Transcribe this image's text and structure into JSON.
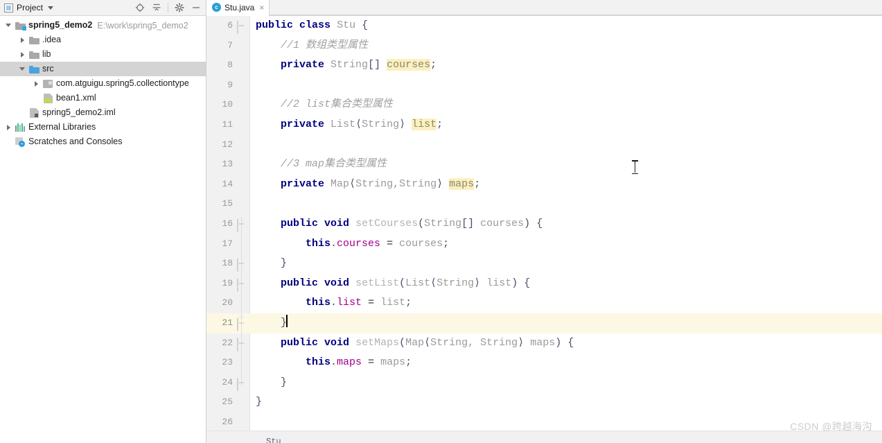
{
  "project_panel": {
    "title": "Project",
    "icon": "project-window-icon",
    "toolbar_buttons": [
      {
        "name": "locate-in-tree-icon",
        "tooltip": "Select Opened File"
      },
      {
        "name": "collapse-all-icon",
        "tooltip": "Collapse All"
      },
      {
        "name": "gear-icon",
        "tooltip": "Settings"
      },
      {
        "name": "minimize-icon",
        "tooltip": "Hide"
      }
    ],
    "tree": [
      {
        "label": "spring5_demo2",
        "sublabel": "E:\\work\\spring5_demo2",
        "icon": "module-folder-icon",
        "indent": 0,
        "twisty": "open",
        "bold": true,
        "selected": false
      },
      {
        "label": ".idea",
        "sublabel": "",
        "icon": "folder-gray-icon",
        "indent": 1,
        "twisty": "closed",
        "bold": false,
        "selected": false
      },
      {
        "label": "lib",
        "sublabel": "",
        "icon": "folder-gray-icon",
        "indent": 1,
        "twisty": "closed",
        "bold": false,
        "selected": false
      },
      {
        "label": "src",
        "sublabel": "",
        "icon": "folder-blue-icon",
        "indent": 1,
        "twisty": "open",
        "bold": false,
        "selected": true
      },
      {
        "label": "com.atguigu.spring5.collectiontype",
        "sublabel": "",
        "icon": "package-icon",
        "indent": 2,
        "twisty": "closed",
        "bold": false,
        "selected": false
      },
      {
        "label": "bean1.xml",
        "sublabel": "",
        "icon": "xml-file-icon",
        "indent": 2,
        "twisty": "none",
        "bold": false,
        "selected": false
      },
      {
        "label": "spring5_demo2.iml",
        "sublabel": "",
        "icon": "iml-file-icon",
        "indent": 1,
        "twisty": "none",
        "bold": false,
        "selected": false
      },
      {
        "label": "External Libraries",
        "sublabel": "",
        "icon": "external-libraries-icon",
        "indent": 0,
        "twisty": "closed",
        "bold": false,
        "selected": false
      },
      {
        "label": "Scratches and Consoles",
        "sublabel": "",
        "icon": "scratches-icon",
        "indent": 0,
        "twisty": "none",
        "bold": false,
        "selected": false
      }
    ]
  },
  "editor": {
    "tab": {
      "label": "Stu.java",
      "icon": "java-class-icon",
      "close": "×"
    },
    "breadcrumb": "Stu",
    "current_line": 21,
    "first_line": 6,
    "lines": [
      {
        "n": 6,
        "fold": "down",
        "tokens": [
          {
            "t": "public",
            "c": "kw"
          },
          {
            "t": " ",
            "c": "plain"
          },
          {
            "t": "class",
            "c": "kw"
          },
          {
            "t": " ",
            "c": "plain"
          },
          {
            "t": "Stu",
            "c": "type"
          },
          {
            "t": " ",
            "c": "plain"
          },
          {
            "t": "{",
            "c": "punct"
          }
        ]
      },
      {
        "n": 7,
        "fold": "none",
        "tokens": [
          {
            "t": "    //1 数组类型属性",
            "c": "cmt"
          }
        ]
      },
      {
        "n": 8,
        "fold": "none",
        "tokens": [
          {
            "t": "    ",
            "c": "plain"
          },
          {
            "t": "private",
            "c": "kw"
          },
          {
            "t": " ",
            "c": "plain"
          },
          {
            "t": "String",
            "c": "type"
          },
          {
            "t": "[]",
            "c": "punct"
          },
          {
            "t": " ",
            "c": "plain"
          },
          {
            "t": "courses",
            "c": "hl"
          },
          {
            "t": ";",
            "c": "punct"
          }
        ]
      },
      {
        "n": 9,
        "fold": "none",
        "tokens": []
      },
      {
        "n": 10,
        "fold": "none",
        "tokens": [
          {
            "t": "    //2 list集合类型属性",
            "c": "cmt"
          }
        ]
      },
      {
        "n": 11,
        "fold": "none",
        "tokens": [
          {
            "t": "    ",
            "c": "plain"
          },
          {
            "t": "private",
            "c": "kw"
          },
          {
            "t": " ",
            "c": "plain"
          },
          {
            "t": "List",
            "c": "type"
          },
          {
            "t": "⟨",
            "c": "punct"
          },
          {
            "t": "String",
            "c": "type"
          },
          {
            "t": "⟩",
            "c": "punct"
          },
          {
            "t": " ",
            "c": "plain"
          },
          {
            "t": "list",
            "c": "hl"
          },
          {
            "t": ";",
            "c": "punct"
          }
        ]
      },
      {
        "n": 12,
        "fold": "none",
        "tokens": []
      },
      {
        "n": 13,
        "fold": "none",
        "tokens": [
          {
            "t": "    //3 map集合类型属性",
            "c": "cmt"
          }
        ]
      },
      {
        "n": 14,
        "fold": "none",
        "tokens": [
          {
            "t": "    ",
            "c": "plain"
          },
          {
            "t": "private",
            "c": "kw"
          },
          {
            "t": " ",
            "c": "plain"
          },
          {
            "t": "Map",
            "c": "type"
          },
          {
            "t": "⟨",
            "c": "punct"
          },
          {
            "t": "String,String",
            "c": "type"
          },
          {
            "t": "⟩",
            "c": "punct"
          },
          {
            "t": " ",
            "c": "plain"
          },
          {
            "t": "maps",
            "c": "hl"
          },
          {
            "t": ";",
            "c": "punct"
          }
        ]
      },
      {
        "n": 15,
        "fold": "none",
        "tokens": []
      },
      {
        "n": 16,
        "fold": "down",
        "tokens": [
          {
            "t": "    ",
            "c": "plain"
          },
          {
            "t": "public",
            "c": "kw"
          },
          {
            "t": " ",
            "c": "plain"
          },
          {
            "t": "void",
            "c": "kw"
          },
          {
            "t": " ",
            "c": "plain"
          },
          {
            "t": "setCourses",
            "c": "method"
          },
          {
            "t": "(",
            "c": "punct"
          },
          {
            "t": "String",
            "c": "type"
          },
          {
            "t": "[]",
            "c": "punct"
          },
          {
            "t": " ",
            "c": "plain"
          },
          {
            "t": "courses",
            "c": "type"
          },
          {
            "t": ")",
            "c": "punct"
          },
          {
            "t": " ",
            "c": "plain"
          },
          {
            "t": "{",
            "c": "punct"
          }
        ]
      },
      {
        "n": 17,
        "fold": "none",
        "tokens": [
          {
            "t": "        ",
            "c": "plain"
          },
          {
            "t": "this",
            "c": "kw"
          },
          {
            "t": ".",
            "c": "punct"
          },
          {
            "t": "courses",
            "c": "field"
          },
          {
            "t": " = ",
            "c": "plain"
          },
          {
            "t": "courses",
            "c": "type"
          },
          {
            "t": ";",
            "c": "punct"
          }
        ]
      },
      {
        "n": 18,
        "fold": "up",
        "tokens": [
          {
            "t": "    ",
            "c": "plain"
          },
          {
            "t": "}",
            "c": "punct"
          }
        ]
      },
      {
        "n": 19,
        "fold": "down",
        "tokens": [
          {
            "t": "    ",
            "c": "plain"
          },
          {
            "t": "public",
            "c": "kw"
          },
          {
            "t": " ",
            "c": "plain"
          },
          {
            "t": "void",
            "c": "kw"
          },
          {
            "t": " ",
            "c": "plain"
          },
          {
            "t": "setList",
            "c": "method"
          },
          {
            "t": "(",
            "c": "punct"
          },
          {
            "t": "List",
            "c": "type"
          },
          {
            "t": "⟨",
            "c": "punct"
          },
          {
            "t": "String",
            "c": "type"
          },
          {
            "t": "⟩",
            "c": "punct"
          },
          {
            "t": " ",
            "c": "plain"
          },
          {
            "t": "list",
            "c": "type"
          },
          {
            "t": ")",
            "c": "punct"
          },
          {
            "t": " ",
            "c": "plain"
          },
          {
            "t": "{",
            "c": "punct"
          }
        ]
      },
      {
        "n": 20,
        "fold": "none",
        "tokens": [
          {
            "t": "        ",
            "c": "plain"
          },
          {
            "t": "this",
            "c": "kw"
          },
          {
            "t": ".",
            "c": "punct"
          },
          {
            "t": "list",
            "c": "field"
          },
          {
            "t": " = ",
            "c": "plain"
          },
          {
            "t": "list",
            "c": "type"
          },
          {
            "t": ";",
            "c": "punct"
          }
        ]
      },
      {
        "n": 21,
        "fold": "up",
        "caret": true,
        "tokens": [
          {
            "t": "    ",
            "c": "plain"
          },
          {
            "t": "}",
            "c": "punct"
          }
        ]
      },
      {
        "n": 22,
        "fold": "down",
        "tokens": [
          {
            "t": "    ",
            "c": "plain"
          },
          {
            "t": "public",
            "c": "kw"
          },
          {
            "t": " ",
            "c": "plain"
          },
          {
            "t": "void",
            "c": "kw"
          },
          {
            "t": " ",
            "c": "plain"
          },
          {
            "t": "setMaps",
            "c": "method"
          },
          {
            "t": "(",
            "c": "punct"
          },
          {
            "t": "Map",
            "c": "type"
          },
          {
            "t": "⟨",
            "c": "punct"
          },
          {
            "t": "String, String",
            "c": "type"
          },
          {
            "t": "⟩",
            "c": "punct"
          },
          {
            "t": " ",
            "c": "plain"
          },
          {
            "t": "maps",
            "c": "type"
          },
          {
            "t": ")",
            "c": "punct"
          },
          {
            "t": " ",
            "c": "plain"
          },
          {
            "t": "{",
            "c": "punct"
          }
        ]
      },
      {
        "n": 23,
        "fold": "none",
        "tokens": [
          {
            "t": "        ",
            "c": "plain"
          },
          {
            "t": "this",
            "c": "kw"
          },
          {
            "t": ".",
            "c": "punct"
          },
          {
            "t": "maps",
            "c": "field"
          },
          {
            "t": " = ",
            "c": "plain"
          },
          {
            "t": "maps",
            "c": "type"
          },
          {
            "t": ";",
            "c": "punct"
          }
        ]
      },
      {
        "n": 24,
        "fold": "up",
        "tokens": [
          {
            "t": "    ",
            "c": "plain"
          },
          {
            "t": "}",
            "c": "punct"
          }
        ]
      },
      {
        "n": 25,
        "fold": "none",
        "tokens": [
          {
            "t": "}",
            "c": "punct"
          }
        ]
      },
      {
        "n": 26,
        "fold": "none",
        "tokens": []
      }
    ]
  },
  "watermark": "CSDN @跨越海沟",
  "colors": {
    "keyword": "#000080",
    "type": "#9a9a9a",
    "comment": "#a0a0a0",
    "field": "#a0008a",
    "field_highlight_bg": "#fcefc0",
    "current_line_bg": "#fdf8e3",
    "panel_bg": "#f2f2f2",
    "gutter_bg": "#f1f1f1",
    "selection_bg": "#d4d4d4",
    "source_root_folder": "#4aa3df"
  }
}
